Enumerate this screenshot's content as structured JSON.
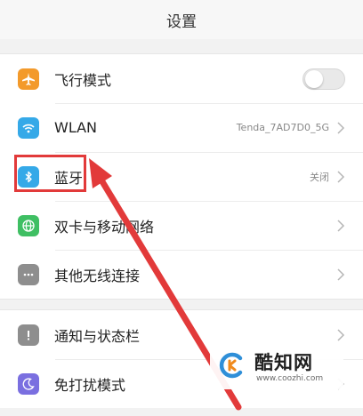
{
  "header": {
    "title": "设置"
  },
  "group1": {
    "items": [
      {
        "label": "飞行模式",
        "icon": "airplane-icon",
        "icon_color": "#f39a2b",
        "toggle_on": false
      },
      {
        "label": "WLAN",
        "icon": "wifi-icon",
        "icon_color": "#35a9e8",
        "value": "Tenda_7AD7D0_5G"
      },
      {
        "label": "蓝牙",
        "icon": "bluetooth-icon",
        "icon_color": "#35a9e8",
        "value": "关闭"
      },
      {
        "label": "双卡与移动网络",
        "icon": "globe-icon",
        "icon_color": "#3fbf63"
      },
      {
        "label": "其他无线连接",
        "icon": "more-dots-icon",
        "icon_color": "#8e8e8e"
      }
    ]
  },
  "group2": {
    "items": [
      {
        "label": "通知与状态栏",
        "icon": "notification-icon",
        "icon_color": "#8e8e8e"
      },
      {
        "label": "免打扰模式",
        "icon": "moon-icon",
        "icon_color": "#7a6fe0"
      }
    ]
  },
  "annotation": {
    "box_color": "#e23a3a",
    "arrow_color": "#e23a3a"
  },
  "watermark": {
    "name": "酷知网",
    "url": "www.coozhi.com"
  }
}
